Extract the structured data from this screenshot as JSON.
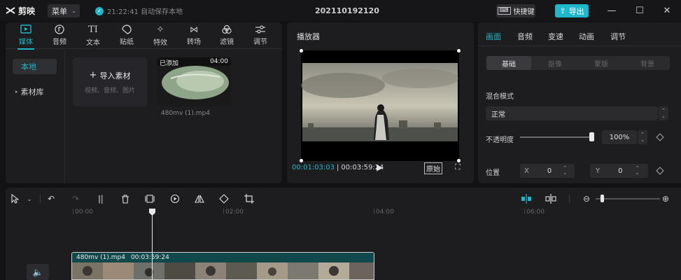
{
  "app": {
    "name": "剪映",
    "menu_label": "菜单",
    "autosave_text": "21:22:41 自动保存本地",
    "project_title": "202110192120",
    "shortcut_label": "快捷键",
    "export_label": "导出",
    "accent": "#1fb7c9"
  },
  "media_tabs": [
    {
      "label": "媒体",
      "icon": "media-icon"
    },
    {
      "label": "音频",
      "icon": "audio-icon"
    },
    {
      "label": "文本",
      "icon": "text-icon"
    },
    {
      "label": "贴纸",
      "icon": "sticker-icon"
    },
    {
      "label": "特效",
      "icon": "effect-icon"
    },
    {
      "label": "转场",
      "icon": "transition-icon"
    },
    {
      "label": "滤镜",
      "icon": "filter-icon"
    },
    {
      "label": "调节",
      "icon": "adjust-icon"
    }
  ],
  "media_side": {
    "local": "本地",
    "library": "素材库"
  },
  "import": {
    "label": "导入素材",
    "hint": "视频、音频、图片"
  },
  "clip": {
    "added": "已添加",
    "duration": "04:00",
    "filename": "480mv (1).mp4"
  },
  "player": {
    "title": "播放器",
    "current_time": "00:01:03:03",
    "total_time": "00:03:59:24",
    "ratio_label": "原始"
  },
  "inspector": {
    "tabs": [
      "画面",
      "音频",
      "变速",
      "动画",
      "调节"
    ],
    "subtabs": [
      "基础",
      "抠像",
      "蒙版",
      "背景"
    ],
    "blend_label": "混合模式",
    "blend_value": "正常",
    "opacity_label": "不透明度",
    "opacity_value": "100%",
    "opacity_level": 1.0,
    "position_label": "位置",
    "x_label": "X",
    "x_value": "0",
    "y_label": "Y",
    "y_value": "0"
  },
  "timeline": {
    "ticks": [
      "00:00",
      "02:00",
      "04:00",
      "06:00"
    ],
    "track_name": "480mv (1).mp4",
    "track_duration": "00:03:59:24"
  }
}
